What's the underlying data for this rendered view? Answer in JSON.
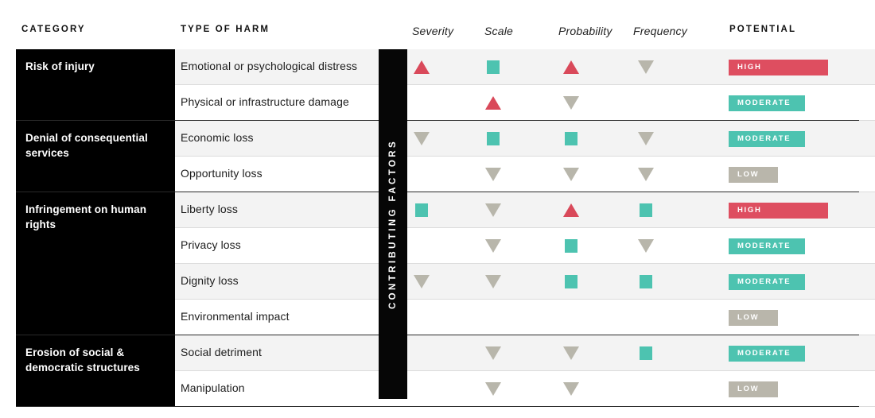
{
  "header": {
    "category": "CATEGORY",
    "type_of_harm": "TYPE OF HARM",
    "severity": "Severity",
    "scale": "Scale",
    "probability": "Probability",
    "frequency": "Frequency",
    "potential": "POTENTIAL"
  },
  "contributing_factors_label": "CONTRIBUTING FACTORS",
  "colors": {
    "high": "#de4e60",
    "moderate": "#4dc3b0",
    "low": "#b9b6ab",
    "category_block": "#000000",
    "row_shade": "#f3f3f3"
  },
  "legend": {
    "up_triangle": "high-marker-icon",
    "square": "moderate-marker-icon",
    "down_triangle": "low-marker-icon"
  },
  "categories": [
    {
      "label": "Risk of injury",
      "rows": 2
    },
    {
      "label": "Denial of consequential services",
      "rows": 2
    },
    {
      "label": "Infringement on human rights",
      "rows": 4
    },
    {
      "label": "Erosion of social & democratic structures",
      "rows": 2
    }
  ],
  "rows": [
    {
      "harm": "Emotional or psychological distress",
      "severity": "up",
      "scale": "square",
      "probability": "up",
      "frequency": "down",
      "potential": "HIGH",
      "potential_level": "high"
    },
    {
      "harm": "Physical or infrastructure damage",
      "severity": "",
      "scale": "up",
      "probability": "down",
      "frequency": "",
      "potential": "MODERATE",
      "potential_level": "moderate"
    },
    {
      "harm": "Economic loss",
      "severity": "down",
      "scale": "square",
      "probability": "square",
      "frequency": "down",
      "potential": "MODERATE",
      "potential_level": "moderate"
    },
    {
      "harm": "Opportunity loss",
      "severity": "",
      "scale": "down",
      "probability": "down",
      "frequency": "down",
      "potential": "LOW",
      "potential_level": "low"
    },
    {
      "harm": "Liberty loss",
      "severity": "square",
      "scale": "down",
      "probability": "up",
      "frequency": "square",
      "potential": "HIGH",
      "potential_level": "high"
    },
    {
      "harm": "Privacy loss",
      "severity": "",
      "scale": "down",
      "probability": "square",
      "frequency": "down",
      "potential": "MODERATE",
      "potential_level": "moderate"
    },
    {
      "harm": "Dignity loss",
      "severity": "down",
      "scale": "down",
      "probability": "square",
      "frequency": "square",
      "potential": "MODERATE",
      "potential_level": "moderate"
    },
    {
      "harm": "Environmental impact",
      "severity": "",
      "scale": "",
      "probability": "",
      "frequency": "",
      "potential": "LOW",
      "potential_level": "low"
    },
    {
      "harm": "Social detriment",
      "severity": "",
      "scale": "down",
      "probability": "down",
      "frequency": "square",
      "potential": "MODERATE",
      "potential_level": "moderate"
    },
    {
      "harm": "Manipulation",
      "severity": "",
      "scale": "down",
      "probability": "down",
      "frequency": "",
      "potential": "LOW",
      "potential_level": "low"
    }
  ]
}
